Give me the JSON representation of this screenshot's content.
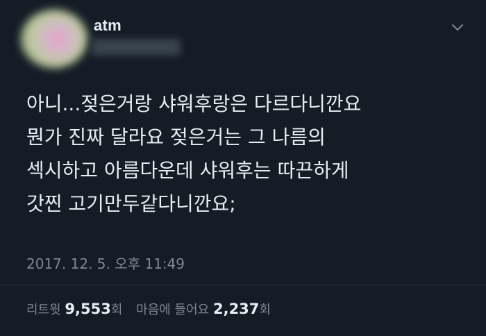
{
  "tweet": {
    "username": "atm",
    "text_lines": [
      "아니...젖은거랑 샤워후랑은 다르다니깐요",
      "뭔가 진짜 달라요 젖은거는 그 나름의",
      "섹시하고 아름다운데 샤워후는 따끈하게",
      "갓찐 고기만두같다니깐요;"
    ],
    "timestamp": "2017. 12. 5. 오후 11:49",
    "retweets": {
      "label": "리트윗",
      "count": "9,553",
      "unit": "회"
    },
    "likes": {
      "label": "마음에 들어요",
      "count": "2,237",
      "unit": "회"
    },
    "icons": {
      "menu": "chevron-down-icon"
    },
    "colors": {
      "background": "#141d26",
      "text": "#e8edf2",
      "muted": "#7d8893"
    }
  }
}
